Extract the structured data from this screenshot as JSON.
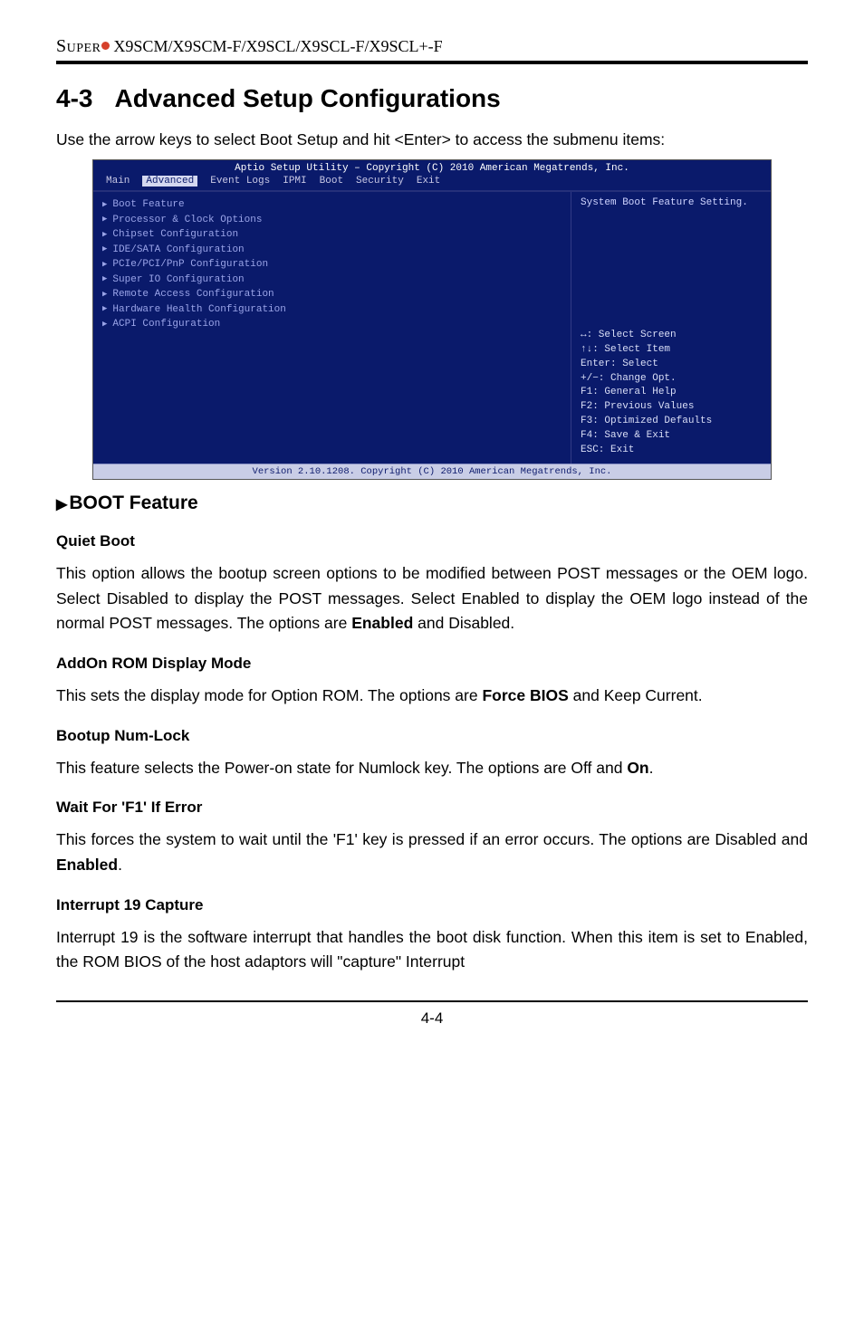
{
  "header": {
    "brand": "Super",
    "models": "X9SCM/X9SCM-F/X9SCL/X9SCL-F/X9SCL+-F"
  },
  "section_heading": {
    "number": "4-3",
    "title": "Advanced Setup Configurations"
  },
  "intro": "Use the arrow keys to select Boot Setup and hit <Enter> to access the submenu items:",
  "bios": {
    "title": "Aptio Setup Utility – Copyright (C) 2010 American Megatrends, Inc.",
    "menu": [
      "Main",
      "Advanced",
      "Event Logs",
      "IPMI",
      "Boot",
      "Security",
      "Exit"
    ],
    "menu_selected_index": 1,
    "left_items": [
      "Boot Feature",
      "Processor & Clock Options",
      "Chipset Configuration",
      "IDE/SATA Configuration",
      "PCIe/PCI/PnP Configuration",
      "Super IO Configuration",
      "Remote Access Configuration",
      "Hardware Health Configuration",
      "ACPI Configuration"
    ],
    "right_hint": "System Boot Feature Setting.",
    "key_help": "↔: Select Screen\n↑↓: Select Item\nEnter: Select\n+/−: Change Opt.\nF1: General Help\nF2: Previous Values\nF3: Optimized Defaults\nF4: Save & Exit\nESC: Exit",
    "footer": "Version 2.10.1208. Copyright (C) 2010 American Megatrends, Inc."
  },
  "boot_feature_heading": "BOOT Feature",
  "subs": {
    "quiet_boot": {
      "title": "Quiet Boot",
      "body_pre": "This option allows the bootup screen options to be modified between POST messages or the OEM logo. Select Disabled to display the POST messages. Select Enabled to display the OEM logo instead of the normal POST messages. The options are ",
      "bold": "Enabled",
      "body_post": " and Disabled."
    },
    "addon_rom": {
      "title": "AddOn ROM Display Mode",
      "body_pre": "This sets the display mode for Option ROM.  The options are ",
      "bold": "Force BIOS",
      "body_post": " and Keep Current."
    },
    "numlock": {
      "title": "Bootup Num-Lock",
      "body_pre": "This feature selects the Power-on state for Numlock key.  The options are Off and ",
      "bold": "On",
      "body_post": "."
    },
    "wait_f1": {
      "title": "Wait For 'F1' If Error",
      "body_pre": "This forces the system to wait until the 'F1' key is pressed if an error occurs.  The options are Disabled and ",
      "bold": "Enabled",
      "body_post": "."
    },
    "int19": {
      "title": "Interrupt 19 Capture",
      "body": "Interrupt 19 is the software interrupt that handles the boot disk function. When this item is set to Enabled, the ROM BIOS of the host adaptors will \"capture\" Interrupt"
    }
  },
  "page_number": "4-4"
}
